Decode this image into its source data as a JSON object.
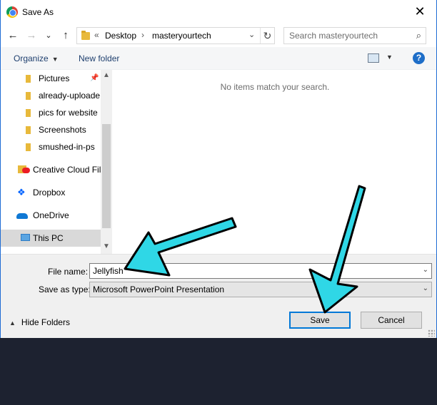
{
  "window": {
    "title": "Save As",
    "close_glyph": "✕"
  },
  "nav": {
    "back_glyph": "←",
    "forward_glyph": "→",
    "recent_glyph": "⌄",
    "up_glyph": "↑",
    "address": {
      "overflow_marker": "«",
      "separator": "›",
      "parts": [
        "Desktop",
        "masteryourtech"
      ],
      "dropdown_glyph": "⌄",
      "refresh_glyph": "↻"
    },
    "search_placeholder": "Search masteryourtech",
    "search_glyph": "⌕"
  },
  "toolbar": {
    "organize_label": "Organize",
    "new_folder_label": "New folder",
    "help_glyph": "?",
    "caret_glyph": "▼"
  },
  "navpane": {
    "items": [
      {
        "label": "Pictures",
        "icon": "folder-icon",
        "pinned": true
      },
      {
        "label": "already-uploade",
        "icon": "folder-icon"
      },
      {
        "label": "pics for website",
        "icon": "folder-icon"
      },
      {
        "label": "Screenshots",
        "icon": "folder-icon"
      },
      {
        "label": "smushed-in-ps",
        "icon": "folder-icon"
      },
      {
        "label": "Creative Cloud Fil",
        "icon": "creative-cloud-icon"
      },
      {
        "label": "Dropbox",
        "icon": "dropbox-icon"
      },
      {
        "label": "OneDrive",
        "icon": "onedrive-icon"
      },
      {
        "label": "This PC",
        "icon": "this-pc-icon",
        "selected": true
      }
    ],
    "scroll_up_glyph": "▲",
    "scroll_down_glyph": "▼"
  },
  "filelist": {
    "empty_message": "No items match your search."
  },
  "form": {
    "file_name_label": "File name:",
    "file_name_value": "Jellyfish",
    "save_as_type_label": "Save as type:",
    "save_as_type_value": "Microsoft PowerPoint Presentation",
    "combo_caret_glyph": "⌄"
  },
  "footer": {
    "hide_folders_label": "Hide Folders",
    "hide_caret_glyph": "▲",
    "save_label": "Save",
    "cancel_label": "Cancel"
  },
  "annotation": {
    "arrow_color": "#2fd7e6",
    "arrow_outline": "#000000"
  }
}
